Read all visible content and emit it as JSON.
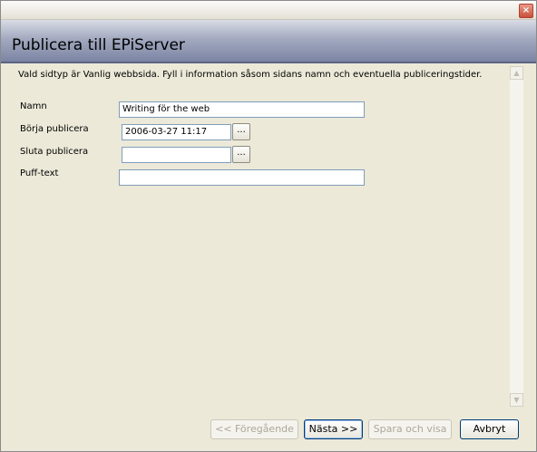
{
  "window": {
    "close_glyph": "×"
  },
  "header": {
    "title": "Publicera till EPiServer"
  },
  "intro": "Vald sidtyp är Vanlig webbsida. Fyll i information såsom sidans namn och eventuella publiceringstider.",
  "form": {
    "name_label": "Namn",
    "name_value": "Writing för the web",
    "start_label": "Börja publicera",
    "start_value": "2006-03-27 11:17",
    "stop_label": "Sluta publicera",
    "stop_value": "",
    "puff_label": "Puff-text",
    "puff_value": "",
    "browse_label": "..."
  },
  "scrollbar": {
    "up_glyph": "▲",
    "down_glyph": "▼"
  },
  "buttons": {
    "prev": "<< Föregående",
    "next": "Nästa >>",
    "save_view": "Spara och visa",
    "cancel": "Avbryt"
  }
}
